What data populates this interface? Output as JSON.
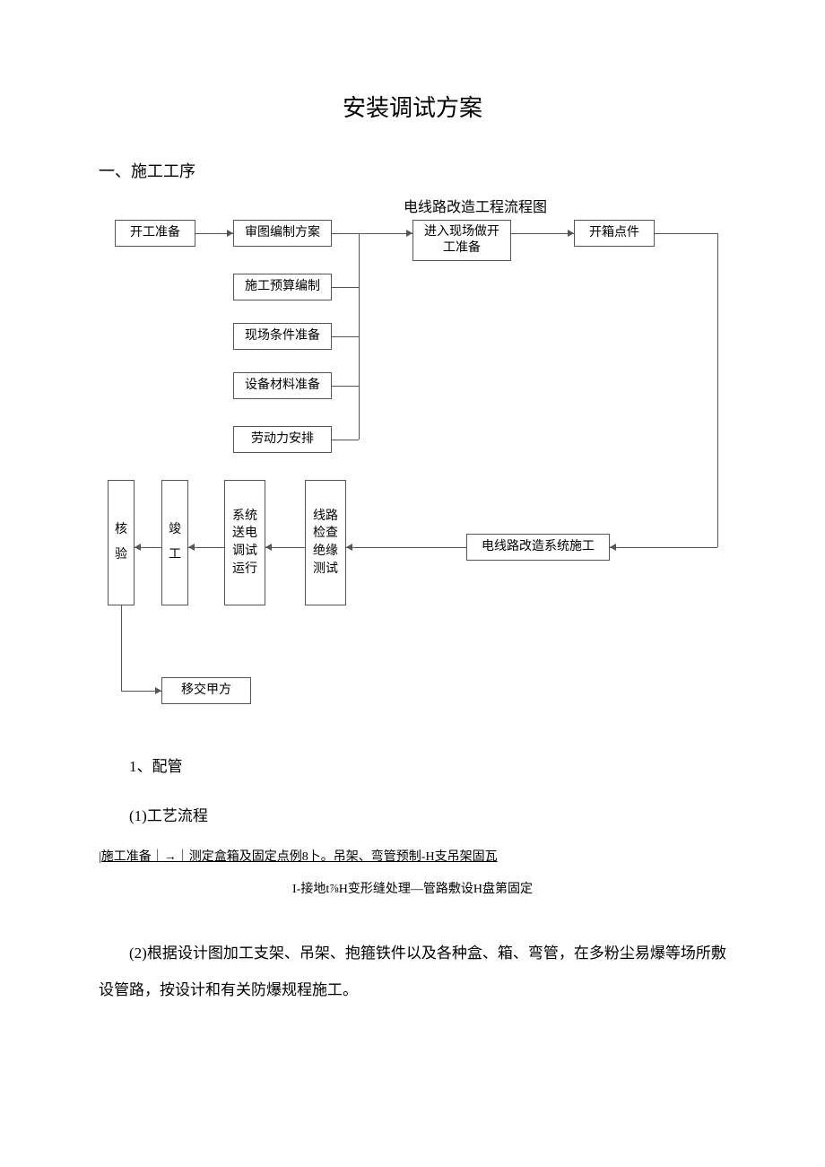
{
  "title": "安装调试方案",
  "section1": "一、施工工序",
  "flow_title": "电线路改造工程流程图",
  "boxes": {
    "b1": "开工准备",
    "b2": "审图编制方案",
    "b3": "进入现场做开工准备",
    "b4": "开箱点件",
    "b5": "施工预算编制",
    "b6": "现场条件准备",
    "b7": "设备材料准备",
    "b8": "劳动力安排",
    "b9": "核验",
    "b10": "竣工",
    "b11": "系统送电调试运行",
    "b12": "线路检查绝缘测试",
    "b13": "电线路改造系统施工",
    "b14": "移交甲方"
  },
  "p1_num": "1、配管",
  "p1_sub": "(1)工艺流程",
  "flow_text1": "|施工准备｜→｜测定盒箱及固定点例8卜。吊架、弯管预制-H支吊架固瓦",
  "flow_text2": "I-接地t⅞H变形缝处理—管路敷设H盘第固定",
  "p2": "(2)根据设计图加工支架、吊架、抱箍铁件以及各种盒、箱、弯管，在多粉尘易爆等场所敷设管路，按设计和有关防爆规程施工。"
}
